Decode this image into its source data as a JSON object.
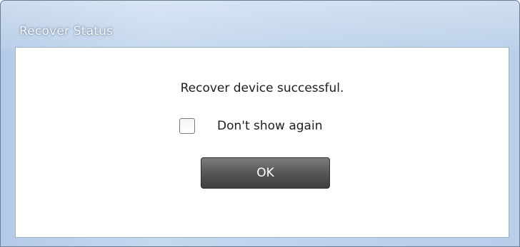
{
  "window": {
    "title": "Recover Status"
  },
  "dialog": {
    "message": "Recover device successful.",
    "checkbox_label": "Don't show again",
    "checkbox_checked": false,
    "ok_label": "OK"
  },
  "colors": {
    "title_bar": "#bdd2ec",
    "button": "#575757",
    "content_background": "#ffffff"
  }
}
